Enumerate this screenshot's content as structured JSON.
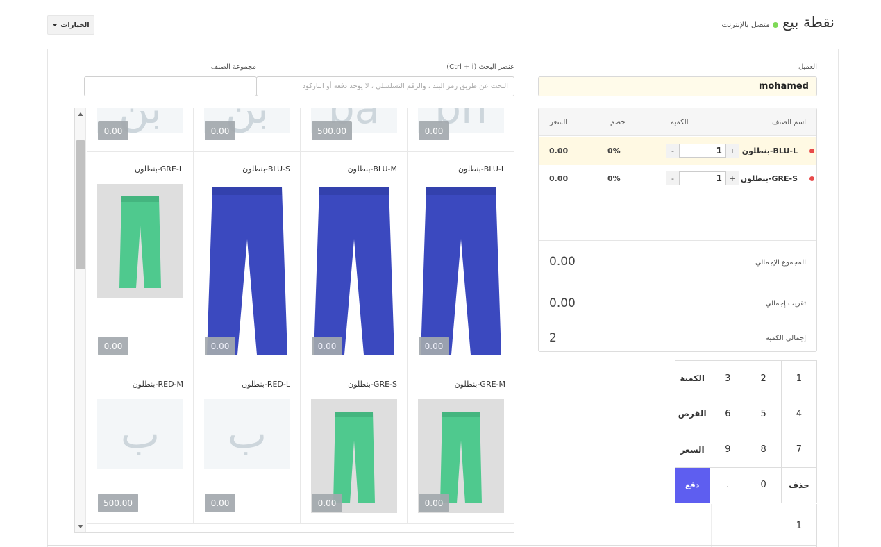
{
  "header": {
    "title": "نقطة بيع",
    "status": "متصل بالإنترنت",
    "options_label": "الخيارات"
  },
  "customer": {
    "label": "العميل",
    "value": "mohamed"
  },
  "search": {
    "label": "عنصر البحث (Ctrl + i)",
    "placeholder": "البحث عن طريق رمز البند ، والرقم التسلسلي ، لا يوجد دفعة أو الباركود"
  },
  "item_group": {
    "label": "مجموعة الصنف"
  },
  "products": {
    "top_row": [
      {
        "price": "0.00",
        "letter": "بن"
      },
      {
        "price": "0.00",
        "letter": "بن"
      },
      {
        "price": "500.00",
        "letter": "ba"
      },
      {
        "price": "0.00",
        "letter": "bn"
      }
    ],
    "row1": [
      {
        "name": "بنطلون-GRE-L",
        "price": "0.00",
        "color": "#4fc98e"
      },
      {
        "name": "بنطلون-BLU-S",
        "price": "0.00",
        "color": "#3b49bf"
      },
      {
        "name": "بنطلون-BLU-M",
        "price": "0.00",
        "color": "#3b49bf"
      },
      {
        "name": "بنطلون-BLU-L",
        "price": "0.00",
        "color": "#3b49bf"
      }
    ],
    "row2": [
      {
        "name": "بنطلون-RED-M",
        "price": "500.00",
        "letter": "ب"
      },
      {
        "name": "بنطلون-RED-L",
        "price": "0.00",
        "letter": "ب"
      },
      {
        "name": "بنطلون-GRE-S",
        "price": "0.00",
        "color": "#4fc98e"
      },
      {
        "name": "بنطلون-GRE-M",
        "price": "0.00",
        "color": "#4fc98e"
      }
    ]
  },
  "order": {
    "columns": {
      "item": "اسم الصنف",
      "qty": "الكمية",
      "discount": "خصم",
      "price": "السعر"
    },
    "items": [
      {
        "name": "بنطلون-BLU-L",
        "qty": "1",
        "discount": "0%",
        "price": "0.00",
        "active": true
      },
      {
        "name": "بنطلون-GRE-S",
        "qty": "1",
        "discount": "0%",
        "price": "0.00",
        "active": false
      }
    ],
    "stepper": {
      "minus": "-",
      "plus": "+"
    },
    "totals": {
      "grand_total_label": "المجموع الإجمالي",
      "grand_total": "0.00",
      "rounded_label": "تقريب إجمالي",
      "rounded": "0.00",
      "qty_label": "إجمالي الكمية",
      "qty": "2"
    }
  },
  "keypad": {
    "keys": [
      "1",
      "2",
      "3",
      "الكمية",
      "4",
      "5",
      "6",
      "القرص",
      "7",
      "8",
      "9",
      "السعر",
      "حذف",
      "0",
      ".",
      "دفع"
    ],
    "display": "1",
    "pay_color": "#5e5ef0"
  }
}
